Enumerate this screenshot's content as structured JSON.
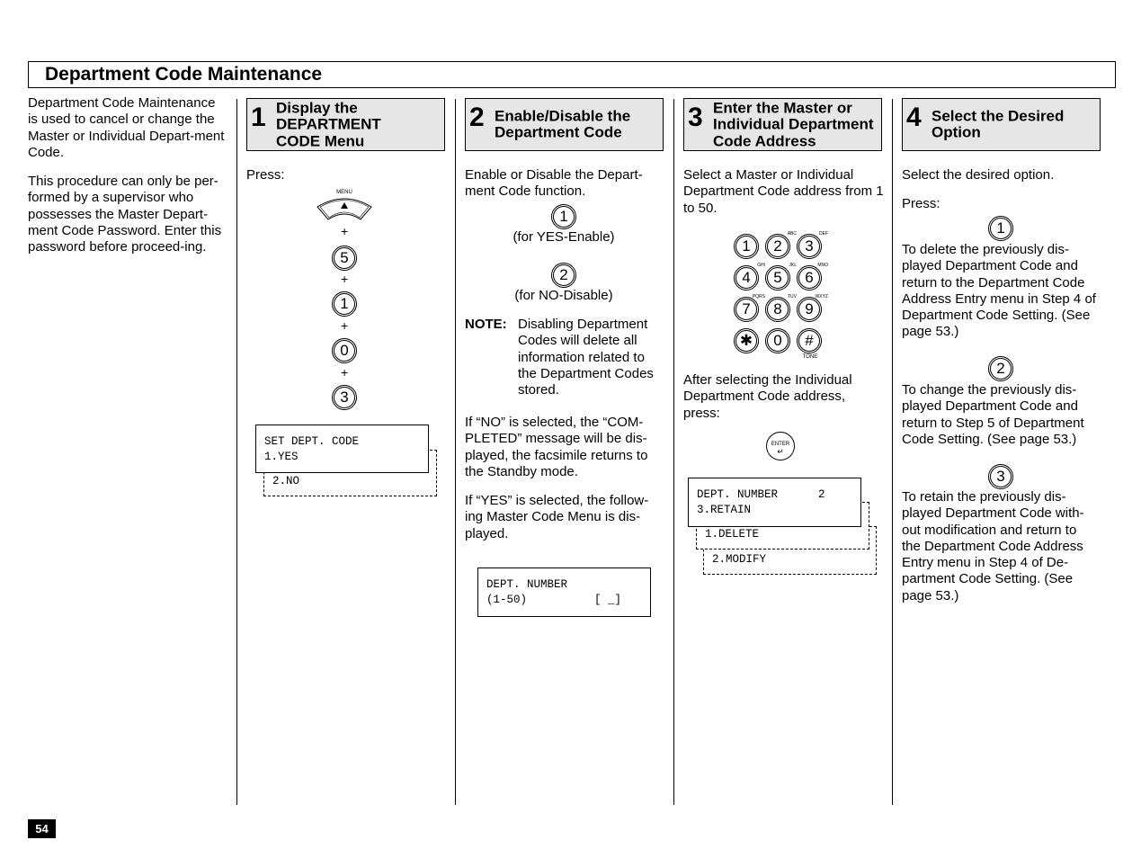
{
  "title": "Department  Code  Maintenance",
  "intro": [
    "Department Code Maintenance is used to cancel or change the Master or Individual Depart-ment Code.",
    "This procedure can only be per-formed by a supervisor who possesses the Master Depart-ment Code Password. Enter this password before proceed-ing."
  ],
  "steps": [
    {
      "num": "1",
      "label": "Display the DEPARTMENT CODE Menu"
    },
    {
      "num": "2",
      "label": "Enable/Disable the Department Code"
    },
    {
      "num": "3",
      "label": "Enter the Master or Individual Department Code Address"
    },
    {
      "num": "4",
      "label": "Select the Desired Option"
    }
  ],
  "col1": {
    "press": "Press:",
    "menu_label": "MENU",
    "keys": [
      "5",
      "1",
      "0",
      "3"
    ],
    "plus": "+",
    "lcd_line1": "SET DEPT. CODE",
    "lcd_line2": "1.YES",
    "lcd_alt": "2.NO"
  },
  "col2": {
    "intro": "Enable or Disable the Depart-ment Code function.",
    "key_yes": "1",
    "yes_caption": "(for  YES-Enable)",
    "key_no": "2",
    "no_caption": "(for NO-Disable)",
    "note_label": "NOTE:",
    "note_text": "Disabling Department Codes will delete all information related to the Department Codes stored.",
    "para_no": "If “NO” is selected, the “COM-PLETED” message will be dis-played, the facsimile returns to the Standby mode.",
    "para_yes": "If “YES” is selected, the follow-ing Master Code Menu is dis-played.",
    "lcd_line1": "DEPT. NUMBER",
    "lcd_line2": "(1-50)          [ _]"
  },
  "col3": {
    "intro": "Select a Master or Individual Department Code address from 1 to 50.",
    "keypad": [
      {
        "k": "1",
        "s": ""
      },
      {
        "k": "2",
        "s": "ABC"
      },
      {
        "k": "3",
        "s": "DEF"
      },
      {
        "k": "4",
        "s": "GHI"
      },
      {
        "k": "5",
        "s": "JKL"
      },
      {
        "k": "6",
        "s": "MNO"
      },
      {
        "k": "7",
        "s": "PQRS"
      },
      {
        "k": "8",
        "s": "TUV"
      },
      {
        "k": "9",
        "s": "WXYZ"
      },
      {
        "k": "✱",
        "s": ""
      },
      {
        "k": "0",
        "s": ""
      },
      {
        "k": "#",
        "s": ""
      }
    ],
    "tone_label": "TONE",
    "after": "After selecting the Individual Department Code address, press:",
    "enter_label": "ENTER",
    "lcd_line1": "DEPT. NUMBER      2",
    "lcd_line2": "3.RETAIN",
    "lcd_alt1": "1.DELETE",
    "lcd_alt2": "2.MODIFY"
  },
  "col4": {
    "intro": "Select  the desired option.",
    "press": "Press:",
    "options": [
      {
        "key": "1",
        "text": "To delete the previously dis-played Department Code and return to the Department Code Address Entry menu in Step 4 of Department Code Setting. (See page 53.)"
      },
      {
        "key": "2",
        "text": "To change the previously dis-played Department Code and return to Step 5 of Department Code Setting. (See page 53.)"
      },
      {
        "key": "3",
        "text": "To retain the previously dis-played Department Code with-out modification and return to the Department Code Address Entry menu in Step 4 of De-partment Code Setting. (See page 53.)"
      }
    ]
  },
  "page_number": "54"
}
